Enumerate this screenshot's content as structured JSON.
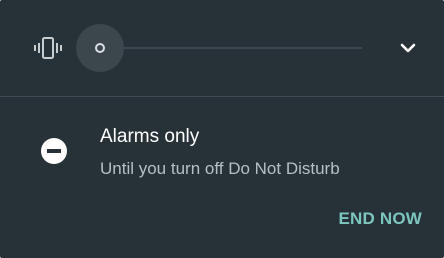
{
  "volume": {
    "mode_icon": "vibrate-icon",
    "level": 0,
    "expand_icon": "chevron-down-icon"
  },
  "dnd": {
    "icon": "do-not-disturb-icon",
    "title": "Alarms only",
    "subtitle": "Until you turn off Do Not Disturb",
    "action_label": "END NOW"
  },
  "colors": {
    "panel_background": "#263238",
    "accent": "#7cc6be",
    "primary_text": "#ffffff",
    "secondary_text": "#b7bfc3"
  }
}
